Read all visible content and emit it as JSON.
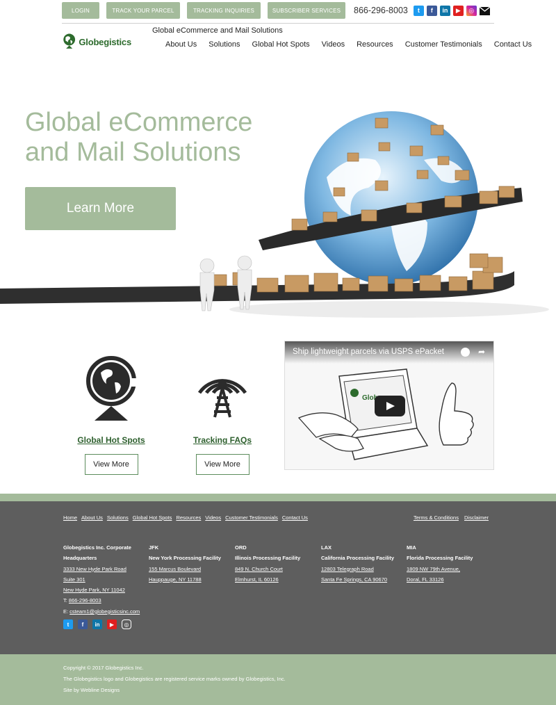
{
  "topbar": {
    "login": "LOGIN",
    "track": "TRACK YOUR PARCEL",
    "inquiries": "TRACKING INQUIRIES",
    "subscriber": "SUBSCRIBER SERVICES",
    "phone": "866-296-8003",
    "social_icons": [
      "twitter-icon",
      "facebook-icon",
      "linkedin-icon",
      "youtube-icon",
      "instagram-icon",
      "email-icon"
    ]
  },
  "header": {
    "logo_text": "Globegistics",
    "tagline": "Global eCommerce and Mail Solutions",
    "nav": [
      "About Us",
      "Solutions",
      "Global Hot Spots",
      "Videos",
      "Resources",
      "Customer Testimonials",
      "Contact Us"
    ]
  },
  "hero": {
    "title_line1": "Global eCommerce",
    "title_line2": "and Mail Solutions",
    "button": "Learn More"
  },
  "features": [
    {
      "link": "Global Hot Spots",
      "button": "View More",
      "icon": "globe-icon"
    },
    {
      "link": "Tracking FAQs",
      "button": "View More",
      "icon": "tower-signal-icon"
    }
  ],
  "video": {
    "title": "Ship lightweight parcels via USPS ePacket",
    "screen_text": "Globe"
  },
  "footer": {
    "nav": [
      "Home",
      "About Us",
      "Solutions",
      "Global Hot Spots",
      "Resources",
      "Videos",
      "Customer Testimonials",
      "Contact Us"
    ],
    "legal": [
      "Terms & Conditions",
      "Disclaimer"
    ],
    "hq": {
      "title1": "Globegistics Inc. Corporate",
      "title2": "Headquarters",
      "line1": "3333 New Hyde Park Road",
      "line2": "Suite 301",
      "line3": "New Hyde Park, NY 11042",
      "phone_label": "T: ",
      "phone": "866-296-8003",
      "email_label": "E: ",
      "email": "csteam1@globegisticsinc.com"
    },
    "locations": [
      {
        "code": "JFK",
        "facility": "New York Processing Facility",
        "line1": "155 Marcus Boulevard",
        "line2": "Hauppauge, NY 11788"
      },
      {
        "code": "ORD",
        "facility": "Illinois Processing Facility",
        "line1": "849 N. Church Court",
        "line2": "Elmhurst, IL  60126"
      },
      {
        "code": "LAX",
        "facility": "California Processing Facility",
        "line1": "12803 Telegraph Road",
        "line2": "Santa Fe Springs, CA  90670"
      },
      {
        "code": "MIA",
        "facility": "Florida Processing Facility",
        "line1": "1809 NW 79th Avenue,",
        "line2": "Doral, FL  33126"
      }
    ],
    "social_icons": [
      "twitter-icon",
      "facebook-icon",
      "linkedin-icon",
      "youtube-icon",
      "instagram-icon"
    ]
  },
  "bottom": {
    "copyright": "Copyright © 2017 Globegistics Inc.",
    "trademark": "The Globegistics logo and Globegistics are registered service marks owned by Globegistics, Inc.",
    "credit": "Site by Webline Designs"
  },
  "colors": {
    "accent_green": "#a4bb9b",
    "dark_green": "#2d6b2d",
    "footer_gray": "#5e5e5e"
  }
}
